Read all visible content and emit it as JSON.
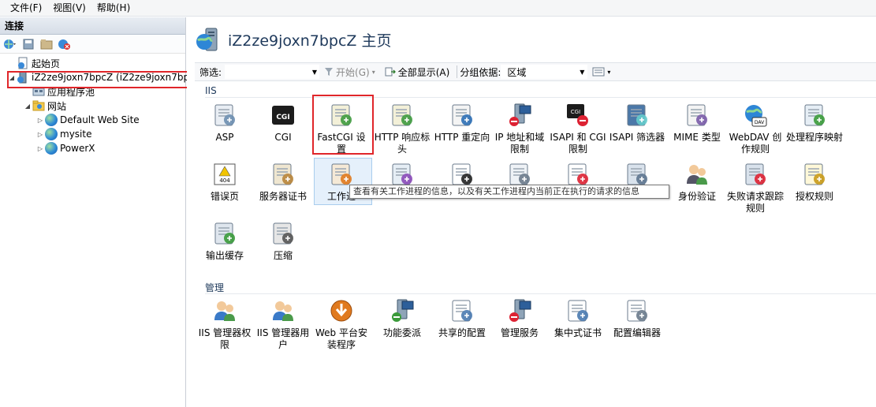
{
  "menu": [
    {
      "label": "文件(F)"
    },
    {
      "label": "视图(V)"
    },
    {
      "label": "帮助(H)"
    }
  ],
  "connections": {
    "title": "连接",
    "tree": {
      "start_page": "起始页",
      "server": "iZ2ze9joxn7bpcZ (iZ2ze9joxn7bp",
      "app_pools": "应用程序池",
      "sites": "网站",
      "site_items": [
        "Default Web Site",
        "mysite",
        "PowerX"
      ]
    }
  },
  "page": {
    "title": "iZ2ze9joxn7bpcZ 主页"
  },
  "filter": {
    "label": "筛选:",
    "go_label": "开始(G)",
    "show_all_label": "全部显示(A)",
    "group_by_label": "分组依据:",
    "group_by_value": "区域"
  },
  "sections": {
    "iis": "IIS",
    "management": "管理"
  },
  "iis_features": [
    {
      "label": "ASP",
      "icon": "asp-icon"
    },
    {
      "label": "CGI",
      "icon": "cgi-icon"
    },
    {
      "label": "FastCGI 设置",
      "icon": "fastcgi-icon"
    },
    {
      "label": "HTTP 响应标头",
      "icon": "http-headers-icon"
    },
    {
      "label": "HTTP 重定向",
      "icon": "http-redirect-icon"
    },
    {
      "label": "IP 地址和域限制",
      "icon": "ip-restrictions-icon"
    },
    {
      "label": "ISAPI 和 CGI 限制",
      "icon": "isapi-cgi-icon"
    },
    {
      "label": "ISAPI 筛选器",
      "icon": "isapi-filter-icon"
    },
    {
      "label": "MIME 类型",
      "icon": "mime-icon"
    },
    {
      "label": "WebDAV 创作规则",
      "icon": "webdav-icon"
    },
    {
      "label": "处理程序映射",
      "icon": "handler-mappings-icon"
    },
    {
      "label": "错误页",
      "icon": "error-pages-icon"
    },
    {
      "label": "服务器证书",
      "icon": "server-certificates-icon"
    },
    {
      "label": "工作进",
      "icon": "worker-processes-icon"
    },
    {
      "label": "",
      "icon": "modules-icon"
    },
    {
      "label": "",
      "icon": "default-document-icon"
    },
    {
      "label": "",
      "icon": "directory-browsing-icon"
    },
    {
      "label": "",
      "icon": "logging-icon"
    },
    {
      "label": "",
      "icon": "request-filtering-icon"
    },
    {
      "label": "身份验证",
      "icon": "authentication-icon"
    },
    {
      "label": "失败请求跟踪规则",
      "icon": "failed-request-icon"
    },
    {
      "label": "授权规则",
      "icon": "authorization-icon"
    },
    {
      "label": "输出缓存",
      "icon": "output-cache-icon"
    },
    {
      "label": "压缩",
      "icon": "compression-icon"
    }
  ],
  "management_features": [
    {
      "label": "IIS 管理器权限",
      "icon": "iis-manager-permissions-icon"
    },
    {
      "label": "IIS 管理器用户",
      "icon": "iis-manager-users-icon"
    },
    {
      "label": "Web 平台安装程序",
      "icon": "web-platform-installer-icon"
    },
    {
      "label": "功能委派",
      "icon": "feature-delegation-icon"
    },
    {
      "label": "共享的配置",
      "icon": "shared-config-icon"
    },
    {
      "label": "管理服务",
      "icon": "management-service-icon"
    },
    {
      "label": "集中式证书",
      "icon": "centralized-certs-icon"
    },
    {
      "label": "配置编辑器",
      "icon": "config-editor-icon"
    }
  ],
  "tooltip": "查看有关工作进程的信息，以及有关工作进程内当前正在执行的请求的信息"
}
